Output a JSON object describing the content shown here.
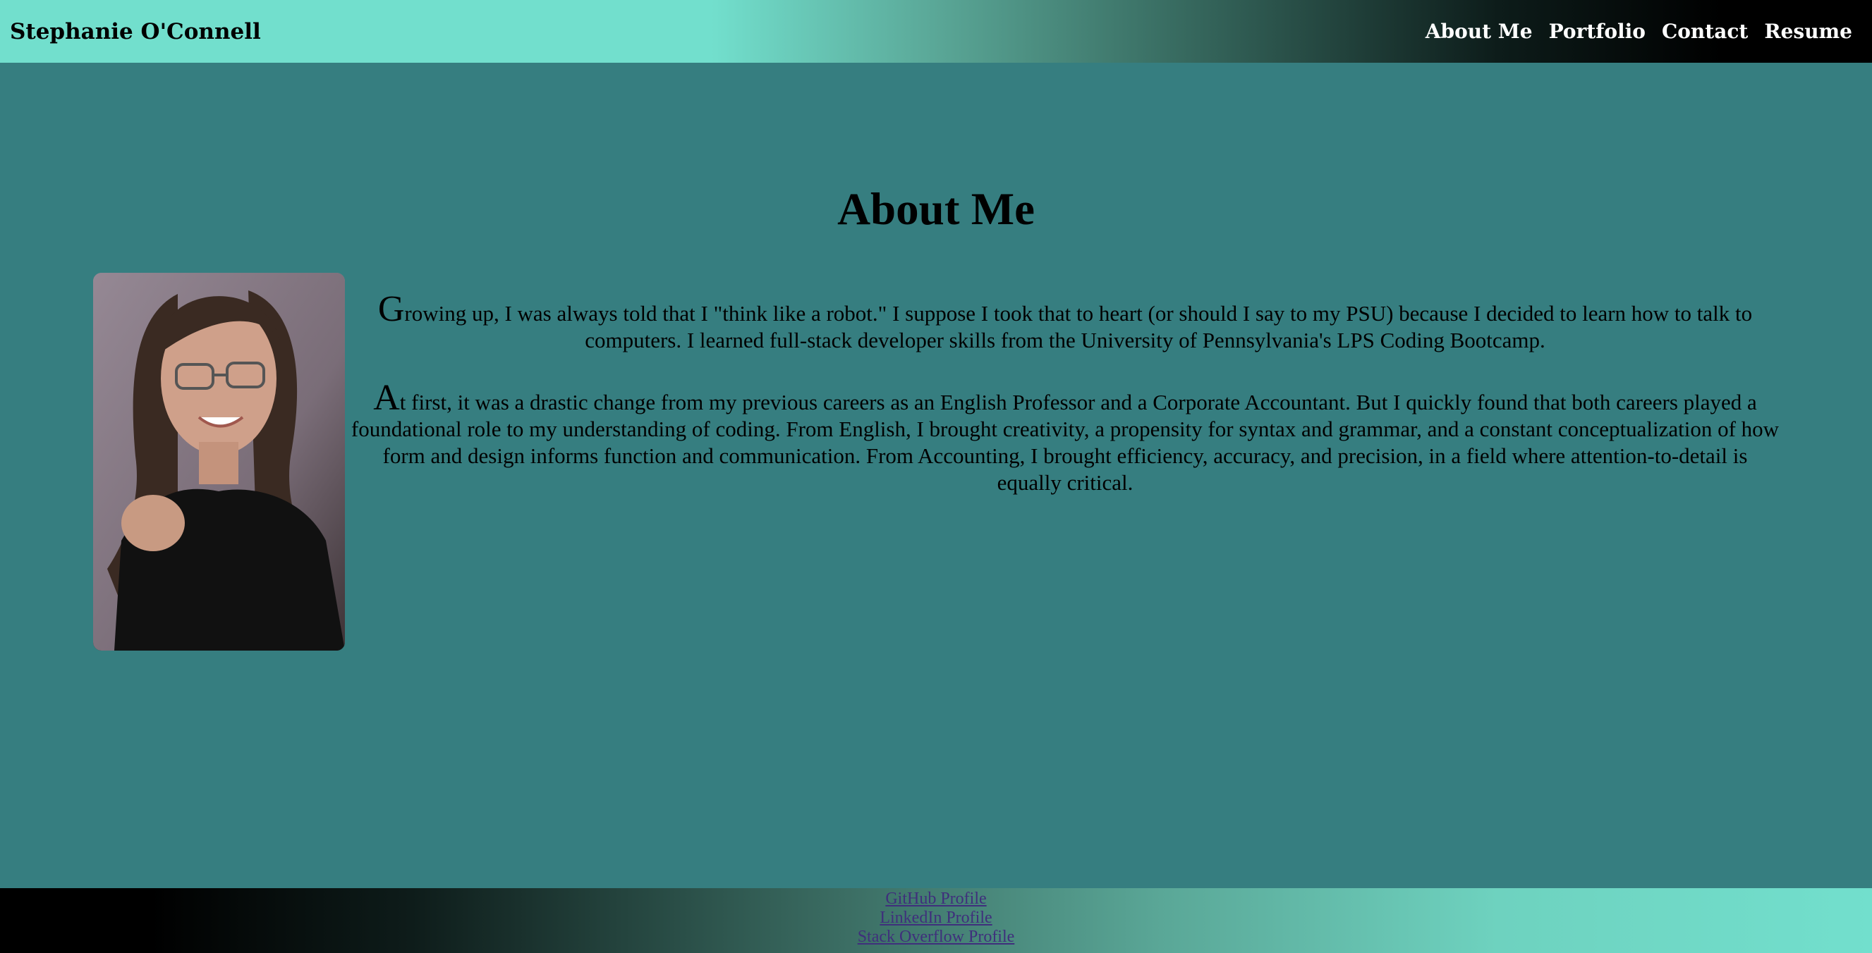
{
  "header": {
    "brand": "Stephanie O'Connell",
    "nav": [
      "About Me",
      "Portfolio",
      "Contact",
      "Resume"
    ]
  },
  "main": {
    "title": "About Me",
    "photo_alt": "portrait photo",
    "paragraphs": [
      {
        "initial": "G",
        "rest": "rowing up, I was always told that I \"think like a robot.\" I suppose I took that to heart (or should I say to my PSU) because I decided to learn how to talk to computers. I learned full-stack developer skills from the University of Pennsylvania's LPS Coding Bootcamp."
      },
      {
        "initial": "A",
        "rest": "t first, it was a drastic change from my previous careers as an English Professor and a Corporate Accountant. But I quickly found that both careers played a foundational role to my understanding of coding. From English, I brought creativity, a propensity for syntax and grammar, and a constant conceptualization of how form and design informs function and communication. From Accounting, I brought efficiency, accuracy, and precision, in a field where attention-to-detail is equally critical."
      }
    ]
  },
  "footer": {
    "links": [
      "GitHub Profile",
      "LinkedIn Profile",
      "Stack Overflow Profile"
    ]
  },
  "colors": {
    "background": "#367e80",
    "header_light": "#72dfcd",
    "footer_link": "#3f2f7c"
  }
}
